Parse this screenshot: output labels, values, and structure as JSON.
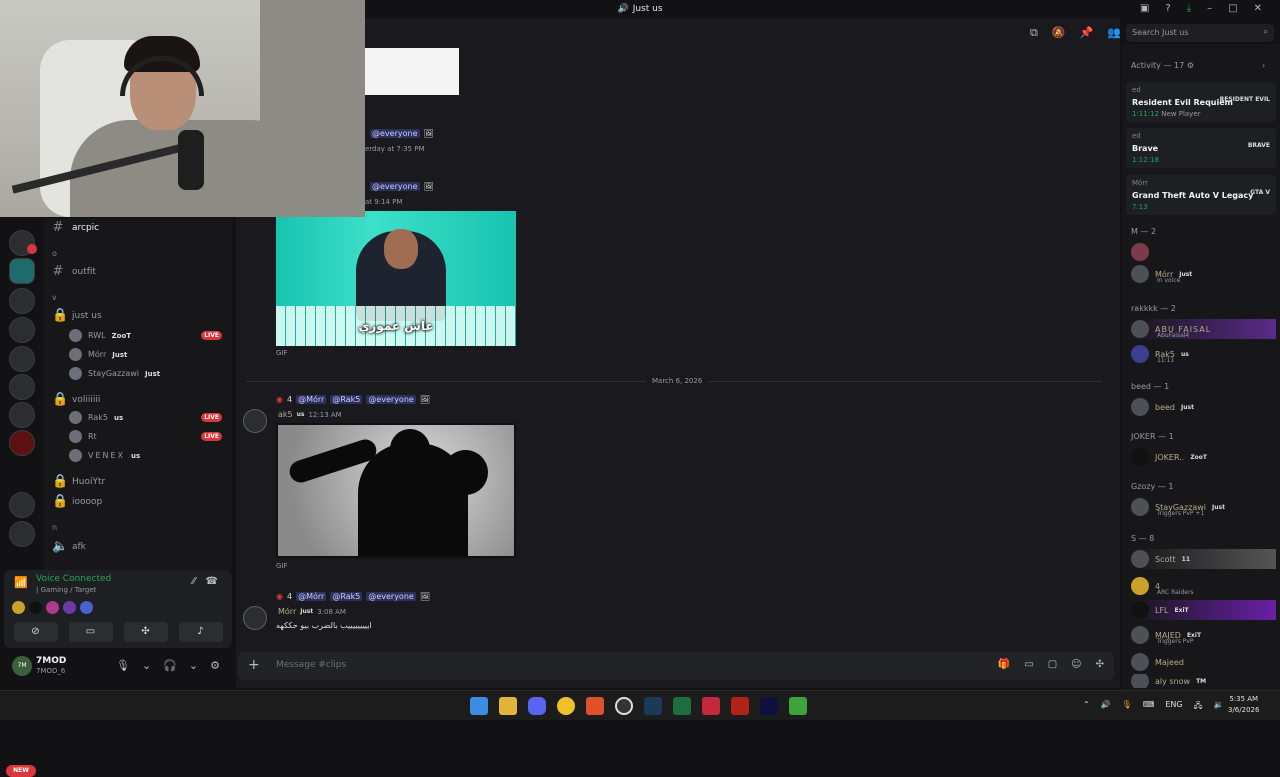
{
  "window": {
    "title": "Just us"
  },
  "channels": {
    "active": "arcpic",
    "items": [
      "outfit",
      "just us",
      "voliiiiii",
      "HuoiYtr",
      "ioooop",
      "afk"
    ],
    "categories": [
      "o",
      "v",
      "n"
    ],
    "voice_users_justus": [
      {
        "name": "RWL",
        "tag": "ZooT",
        "live": "LIVE"
      },
      {
        "name": "Mórr",
        "tag": "Just"
      },
      {
        "name": "StayGazzawi",
        "tag": "Just"
      }
    ],
    "voice_users_voli": [
      {
        "name": "Rak5",
        "tag": "us",
        "live": "LIVE"
      },
      {
        "name": "Rt",
        "live": "LIVE"
      },
      {
        "name": "VENEX",
        "tag": "us"
      }
    ]
  },
  "voice": {
    "title": "Voice Connected",
    "subtitle": "| Gaming / Target"
  },
  "user": {
    "name": "7MOD",
    "status": "7MOD_6",
    "avatar": "7M"
  },
  "rail": {
    "new_label": "NEW"
  },
  "chat": {
    "msg1": {
      "mention": "@everyone",
      "time": "erday at 7:35 PM"
    },
    "msg2": {
      "mention": "@everyone",
      "time": "at 9:14 PM"
    },
    "gif1": {
      "caption": "عاش عموري",
      "label": "GIF"
    },
    "divider": "March 6, 2026",
    "msg3": {
      "prefix": "4",
      "mentions": [
        "@Mórr",
        "@Rak5",
        "@everyone"
      ],
      "author": "ak5",
      "tag": "us",
      "time": "12:13 AM"
    },
    "gif2": {
      "label": "GIF"
    },
    "msg4": {
      "prefix": "4",
      "mentions": [
        "@Mórr",
        "@Rak5",
        "@everyone"
      ],
      "author": "Mórr",
      "tag": "Just",
      "time": "3:08 AM",
      "body": "ايييييييييب بالضرب بيو حككهه"
    },
    "composer_placeholder": "Message #clips"
  },
  "search": {
    "placeholder": "Search Just us"
  },
  "activity": {
    "header": "Activity — 17",
    "cards": [
      {
        "user": "ed",
        "game": "Resident Evil Requiem",
        "time": "1:11:12",
        "extra": "New Player",
        "logo": "RESIDENT EVIL"
      },
      {
        "user": "ed",
        "game": "Brave",
        "time": "1:12:18",
        "logo": "BRAVE"
      },
      {
        "user": "Mórr",
        "game": "Grand Theft Auto V Legacy",
        "time": "7:13",
        "logo": "GTA V"
      }
    ]
  },
  "members": {
    "groups": [
      {
        "label": "M — 2"
      },
      {
        "label": "rakkkk — 2"
      },
      {
        "label": "beed — 1"
      },
      {
        "label": "JOKER — 1"
      },
      {
        "label": "Gzozy — 1"
      },
      {
        "label": "S — 8"
      }
    ],
    "list": [
      {
        "name": "Mórr",
        "tag": "Just",
        "status": "In voice"
      },
      {
        "name": "ABU FAISAL",
        "status": "AbuFaisal4"
      },
      {
        "name": "Rak5",
        "tag": "us",
        "status": "11:11"
      },
      {
        "name": "beed",
        "tag": "Just"
      },
      {
        "name": "JOKER..",
        "tag": "ZooT"
      },
      {
        "name": "StayGazzawi",
        "tag": "Just",
        "status": "Triggers PvP +1"
      },
      {
        "name": "Scott",
        "tag": "11"
      },
      {
        "name": "4",
        "status": "ARC Raiders"
      },
      {
        "name": "LFL",
        "tag": "ExiT"
      },
      {
        "name": "MAJED",
        "tag": "ExiT",
        "status": "Triggers PvP"
      },
      {
        "name": "Majeed"
      },
      {
        "name": "aly snow",
        "tag": "TM"
      }
    ]
  },
  "taskbar": {
    "lang": "ENG",
    "time": "5:35 AM",
    "date": "3/6/2026"
  },
  "colors": {
    "accent": "#5865f2",
    "live": "#da373c",
    "online": "#23a55a"
  }
}
